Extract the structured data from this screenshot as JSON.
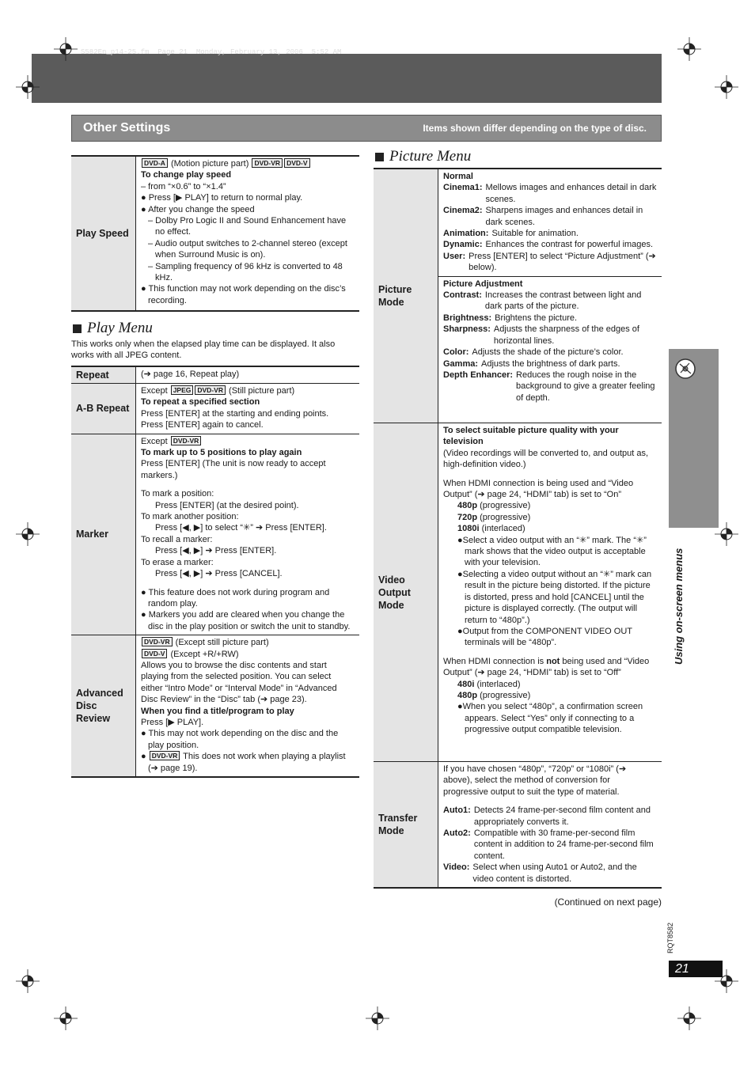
{
  "file_info": "S582En_p14-25.fm  Page 21  Monday, February 13, 2006  5:52 AM",
  "header": {
    "title": "Other Settings",
    "subtitle": "Items shown differ depending on the type of disc."
  },
  "play_speed": {
    "label": "Play Speed",
    "lines": [
      {
        "k": "n",
        "p": [
          {
            "tag": "DVD-A"
          },
          " (Motion picture part) ",
          {
            "tag": "DVD-VR"
          },
          {
            "tag": "DVD-V"
          }
        ]
      },
      {
        "k": "b",
        "p": [
          "To change play speed"
        ]
      },
      {
        "k": "n",
        "p": [
          "– from “×0.6” to “×1.4”"
        ]
      },
      {
        "k": "bl",
        "p": [
          "● Press [▶ PLAY] to return to normal play."
        ]
      },
      {
        "k": "bl",
        "p": [
          "● After you change the speed"
        ]
      },
      {
        "k": "d",
        "p": [
          "– Dolby Pro Logic II and Sound Enhancement have no effect."
        ]
      },
      {
        "k": "d",
        "p": [
          "– Audio output switches to 2-channel stereo (except when Surround Music is on)."
        ]
      },
      {
        "k": "d",
        "p": [
          "– Sampling frequency of 96 kHz is converted to 48 kHz."
        ]
      },
      {
        "k": "bl",
        "p": [
          "● This function may not work depending on the disc’s recording."
        ]
      }
    ]
  },
  "play_menu": {
    "heading": "Play Menu",
    "note": "This works only when the elapsed play time can be displayed. It also works with all JPEG content.",
    "rows": [
      {
        "label": "Repeat",
        "lines": [
          {
            "k": "n",
            "p": [
              "(➔ page 16, Repeat play)"
            ]
          }
        ]
      },
      {
        "label": "A-B Repeat",
        "lines": [
          {
            "k": "n",
            "p": [
              "Except ",
              {
                "tag": "JPEG"
              },
              {
                "tag": "DVD-VR"
              },
              " (Still picture part)"
            ]
          },
          {
            "k": "b",
            "p": [
              "To repeat a specified section"
            ]
          },
          {
            "k": "n",
            "p": [
              "Press [ENTER] at the starting and ending points."
            ]
          },
          {
            "k": "n",
            "p": [
              "Press [ENTER] again to cancel."
            ]
          }
        ]
      },
      {
        "label": "Marker",
        "lines": [
          {
            "k": "n",
            "p": [
              "Except ",
              {
                "tag": "DVD-VR"
              }
            ]
          },
          {
            "k": "b",
            "p": [
              "To mark up to 5 positions to play again"
            ]
          },
          {
            "k": "n",
            "p": [
              "Press [ENTER] (The unit is now ready to accept markers.)"
            ]
          },
          {
            "k": "g",
            "p": []
          },
          {
            "k": "n",
            "p": [
              "To mark a position:"
            ]
          },
          {
            "k": "i",
            "p": [
              "Press [ENTER] (at the desired point)."
            ]
          },
          {
            "k": "n",
            "p": [
              "To mark another position:"
            ]
          },
          {
            "k": "i",
            "p": [
              "Press [◀, ▶] to select “✳” ➔ Press [ENTER]."
            ]
          },
          {
            "k": "n",
            "p": [
              "To recall a marker:"
            ]
          },
          {
            "k": "i",
            "p": [
              "Press [◀, ▶] ➔ Press [ENTER]."
            ]
          },
          {
            "k": "n",
            "p": [
              "To erase a marker:"
            ]
          },
          {
            "k": "i",
            "p": [
              "Press [◀, ▶] ➔ Press [CANCEL]."
            ]
          },
          {
            "k": "g",
            "p": []
          },
          {
            "k": "bl",
            "p": [
              "● This feature does not work during program and random play."
            ]
          },
          {
            "k": "bl",
            "p": [
              "● Markers you add are cleared when you change the disc in the play position or switch the unit to standby."
            ]
          }
        ]
      },
      {
        "label": "Advanced Disc Review",
        "lines": [
          {
            "k": "n",
            "p": [
              {
                "tag": "DVD-VR"
              },
              " (Except still picture part)"
            ]
          },
          {
            "k": "n",
            "p": [
              {
                "tag": "DVD-V"
              },
              " (Except +R/+RW)"
            ]
          },
          {
            "k": "n",
            "p": [
              "Allows you to browse the disc contents and start playing from the selected position. You can select either “Intro Mode” or “Interval Mode” in “Advanced Disc Review” in the “Disc” tab (➔ page 23)."
            ]
          },
          {
            "k": "b",
            "p": [
              "When you find a title/program to play"
            ]
          },
          {
            "k": "n",
            "p": [
              "Press [▶ PLAY]."
            ]
          },
          {
            "k": "bl",
            "p": [
              "● This may not work depending on the disc and the play position."
            ]
          },
          {
            "k": "bl",
            "p": [
              "● ",
              {
                "tag": "DVD-VR"
              },
              " This does not work when playing a playlist (➔ page 19)."
            ]
          }
        ]
      }
    ]
  },
  "picture_menu": {
    "heading": "Picture Menu",
    "rows": [
      {
        "label": "Picture Mode",
        "blocks": [
          {
            "lines": [
              {
                "k": "b",
                "p": [
                  "Normal"
                ]
              },
              {
                "k": "def",
                "term": "Cinema1:",
                "p": [
                  "Mellows images and enhances detail in dark scenes."
                ]
              },
              {
                "k": "def",
                "term": "Cinema2:",
                "p": [
                  "Sharpens images and enhances detail in dark scenes."
                ]
              },
              {
                "k": "def",
                "term": "Animation:",
                "p": [
                  "Suitable for animation."
                ]
              },
              {
                "k": "def",
                "term": "Dynamic:",
                "p": [
                  "Enhances the contrast for powerful images."
                ]
              },
              {
                "k": "def",
                "term": "User:",
                "p": [
                  "Press [ENTER] to select “Picture Adjustment” (➔ below)."
                ]
              }
            ]
          },
          {
            "lines": [
              {
                "k": "b",
                "p": [
                  "Picture Adjustment"
                ]
              },
              {
                "k": "def",
                "term": "Contrast:",
                "p": [
                  "Increases the contrast between light and dark parts of the picture."
                ]
              },
              {
                "k": "def",
                "term": "Brightness:",
                "p": [
                  "Brightens the picture."
                ]
              },
              {
                "k": "def",
                "term": "Sharpness:",
                "p": [
                  "Adjusts the sharpness of the edges of horizontal lines."
                ]
              },
              {
                "k": "def",
                "term": "Color:",
                "p": [
                  "Adjusts the shade of the picture’s color."
                ]
              },
              {
                "k": "def",
                "term": "Gamma:",
                "p": [
                  "Adjusts the brightness of dark parts."
                ]
              },
              {
                "k": "def",
                "term": "Depth Enhancer:",
                "p": [
                  "Reduces the rough noise in the background to give a greater feeling of depth."
                ]
              }
            ]
          }
        ]
      },
      {
        "label": "Video Output Mode",
        "blocks": [
          {
            "lines": [
              {
                "k": "b",
                "p": [
                  "To select suitable picture quality with your television"
                ]
              },
              {
                "k": "n",
                "p": [
                  "(Video recordings will be converted to, and output as, high-definition video.)"
                ]
              },
              {
                "k": "g",
                "p": []
              },
              {
                "k": "n",
                "p": [
                  "When HDMI connection is being used and “Video Output” (➔ page 24, “HDMI” tab) is set to “On”"
                ]
              },
              {
                "k": "i2",
                "p": [
                  {
                    "b": "480p"
                  },
                  " (progressive)"
                ]
              },
              {
                "k": "i2",
                "p": [
                  {
                    "b": "720p"
                  },
                  " (progressive)"
                ]
              },
              {
                "k": "i2",
                "p": [
                  {
                    "b": "1080i"
                  },
                  " (interlaced)"
                ]
              },
              {
                "k": "c",
                "p": [
                  "●Select a video output with an “✳” mark. The “✳” mark shows that the video output is acceptable with your television."
                ]
              },
              {
                "k": "c",
                "p": [
                  "●Selecting a video output without an “✳” mark can result in the picture being distorted. If the picture is distorted, press and hold [CANCEL] until the picture is displayed correctly. (The output will return to “480p”.)"
                ]
              },
              {
                "k": "c",
                "p": [
                  "●Output from the COMPONENT VIDEO OUT terminals will be “480p”."
                ]
              },
              {
                "k": "g",
                "p": []
              },
              {
                "k": "n",
                "p": [
                  "When HDMI connection is ",
                  {
                    "b": "not"
                  },
                  " being used and “Video Output” (➔ page 24, “HDMI” tab) is set to “Off”"
                ]
              },
              {
                "k": "i2",
                "p": [
                  {
                    "b": "480i"
                  },
                  " (interlaced)"
                ]
              },
              {
                "k": "i2",
                "p": [
                  {
                    "b": "480p"
                  },
                  " (progressive)"
                ]
              },
              {
                "k": "c",
                "p": [
                  "●When you select “480p”, a confirmation screen appears. Select “Yes” only if connecting to a progressive output compatible television."
                ]
              }
            ]
          }
        ]
      },
      {
        "label": "Transfer Mode",
        "blocks": [
          {
            "lines": [
              {
                "k": "n",
                "p": [
                  "If you have chosen “480p”, “720p” or “1080i” (➔ above), select the method of conversion for progressive output to suit the type of material."
                ]
              },
              {
                "k": "g",
                "p": []
              },
              {
                "k": "def",
                "term": "Auto1:",
                "p": [
                  "Detects 24 frame-per-second film content and appropriately converts it."
                ]
              },
              {
                "k": "def",
                "term": "Auto2:",
                "p": [
                  "Compatible with 30 frame-per-second film content in addition to 24 frame-per-second film content."
                ]
              },
              {
                "k": "def",
                "term": "Video:",
                "p": [
                  "Select when using Auto1 or Auto2, and the video content is distorted."
                ]
              }
            ]
          }
        ]
      }
    ]
  },
  "continued": "(Continued on next page)",
  "side_tab": {
    "text": "Using on-screen menus",
    "icon": "disc-icon"
  },
  "model_code": "RQT8582",
  "page_number": "21"
}
